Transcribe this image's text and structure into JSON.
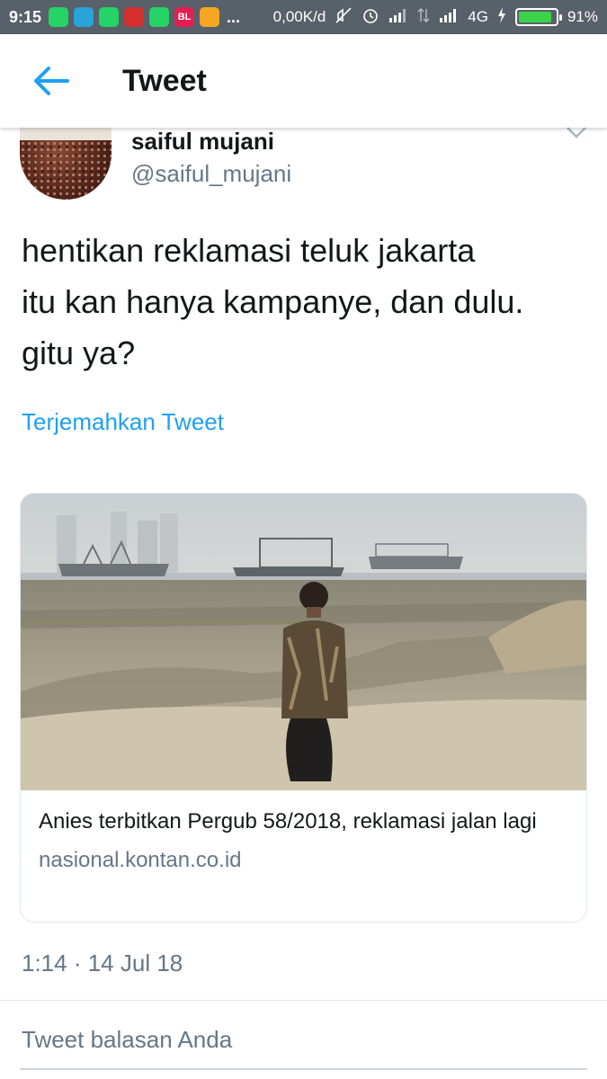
{
  "status_bar": {
    "time": "9:15",
    "dots": "...",
    "network_speed": "0,00K/d",
    "network_type": "4G",
    "battery_percent_label": "91%",
    "battery_level": 0.91,
    "notification_icons": [
      {
        "icon": "whatsapp-icon",
        "color": "#25d366",
        "glyph": ""
      },
      {
        "icon": "telegram-icon",
        "color": "#2aa3d8",
        "glyph": ""
      },
      {
        "icon": "whatsapp-icon",
        "color": "#25d366",
        "glyph": ""
      },
      {
        "icon": "app-icon-red",
        "color": "#d32f2f",
        "glyph": ""
      },
      {
        "icon": "whatsapp-icon",
        "color": "#25d366",
        "glyph": ""
      },
      {
        "icon": "bukalapak-icon",
        "color": "#e31e52",
        "glyph": "BL"
      },
      {
        "icon": "app-icon-orange",
        "color": "#f5a623",
        "glyph": ""
      }
    ]
  },
  "app_bar": {
    "title": "Tweet"
  },
  "tweet": {
    "author_name": "saiful mujani",
    "author_handle": "@saiful_mujani",
    "text": "hentikan reklamasi teluk jakarta\nitu kan hanya kampanye, dan dulu.\ngitu ya?",
    "translate_label": "Terjemahkan Tweet",
    "timestamp": "1:14 · 14 Jul 18"
  },
  "card": {
    "title": "Anies terbitkan Pergub 58/2018, reklamasi jalan lagi",
    "domain": "nasional.kontan.co.id"
  },
  "reply": {
    "placeholder": "Tweet balasan Anda"
  },
  "colors": {
    "accent": "#1da1f2",
    "secondary_text": "#657786",
    "status_bar_bg": "#586069"
  }
}
